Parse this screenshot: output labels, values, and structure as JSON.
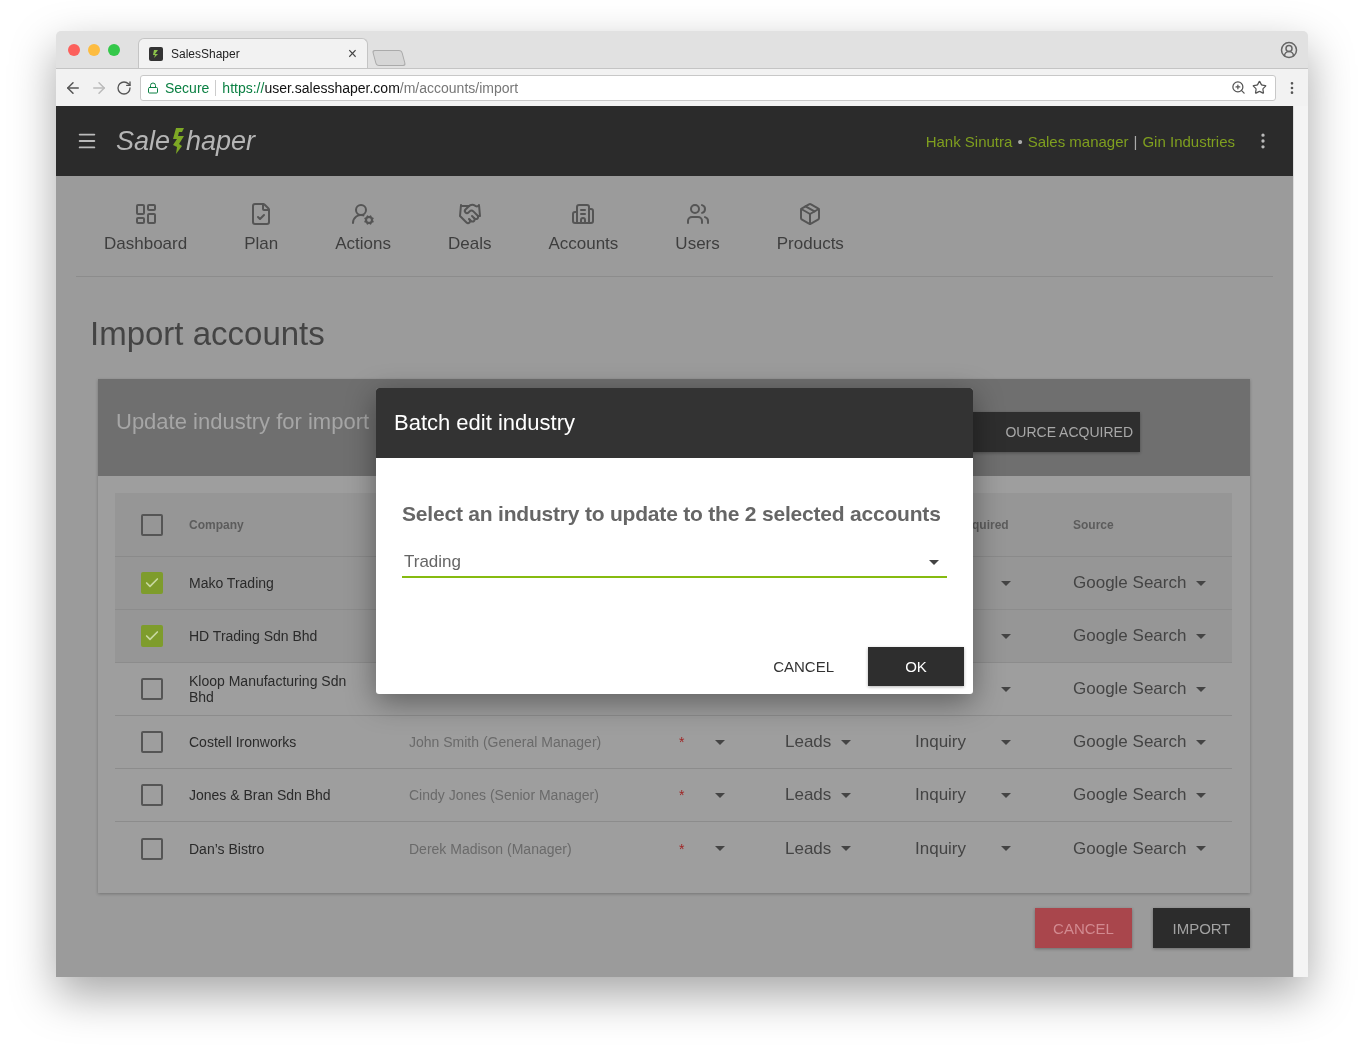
{
  "browser": {
    "tab_title": "SalesShaper",
    "tab_close": "×",
    "secure_label": "Secure",
    "url": {
      "scheme": "https://",
      "host": "user.salesshaper.com",
      "path": "/m/accounts/import"
    }
  },
  "app_bar": {
    "logo": {
      "left": "Sale",
      "right": "haper"
    },
    "user": {
      "name": "Hank Sinutra",
      "dot": "•",
      "role": "Sales manager",
      "bar": "|",
      "company": "Gin Industries"
    }
  },
  "nav": [
    {
      "label": "Dashboard"
    },
    {
      "label": "Plan"
    },
    {
      "label": "Actions"
    },
    {
      "label": "Deals"
    },
    {
      "label": "Accounts"
    },
    {
      "label": "Users"
    },
    {
      "label": "Products"
    }
  ],
  "page_title": "Import accounts",
  "card": {
    "heading": "Update industry for import",
    "header_button": "OURCE ACQUIRED"
  },
  "table": {
    "header_checked": false,
    "columns": {
      "company": "Company",
      "type": "quired",
      "source": "Source"
    },
    "rows": [
      {
        "checked": true,
        "company": "Mako Trading",
        "source": "Google Search"
      },
      {
        "checked": true,
        "company": "HD Trading Sdn Bhd",
        "source": "Google Search"
      },
      {
        "checked": false,
        "company": "Kloop Manufacturing Sdn Bhd",
        "source": "Google Search"
      },
      {
        "checked": false,
        "company": "Costell Ironworks",
        "contact": "John Smith (General Manager)",
        "required": "*",
        "stage": "Leads",
        "type": "Inquiry",
        "source": "Google Search"
      },
      {
        "checked": false,
        "company": "Jones & Bran Sdn Bhd",
        "contact": "Cindy Jones (Senior Manager)",
        "required": "*",
        "stage": "Leads",
        "type": "Inquiry",
        "source": "Google Search"
      },
      {
        "checked": false,
        "company": "Dan’s Bistro",
        "contact": "Derek Madison (Manager)",
        "required": "*",
        "stage": "Leads",
        "type": "Inquiry",
        "source": "Google Search"
      }
    ]
  },
  "actions": {
    "cancel": "CANCEL",
    "import": "IMPORT"
  },
  "dialog": {
    "title": "Batch edit industry",
    "prompt": "Select an industry to update to the 2 selected accounts",
    "value": "Trading",
    "cancel": "CANCEL",
    "ok": "OK"
  }
}
